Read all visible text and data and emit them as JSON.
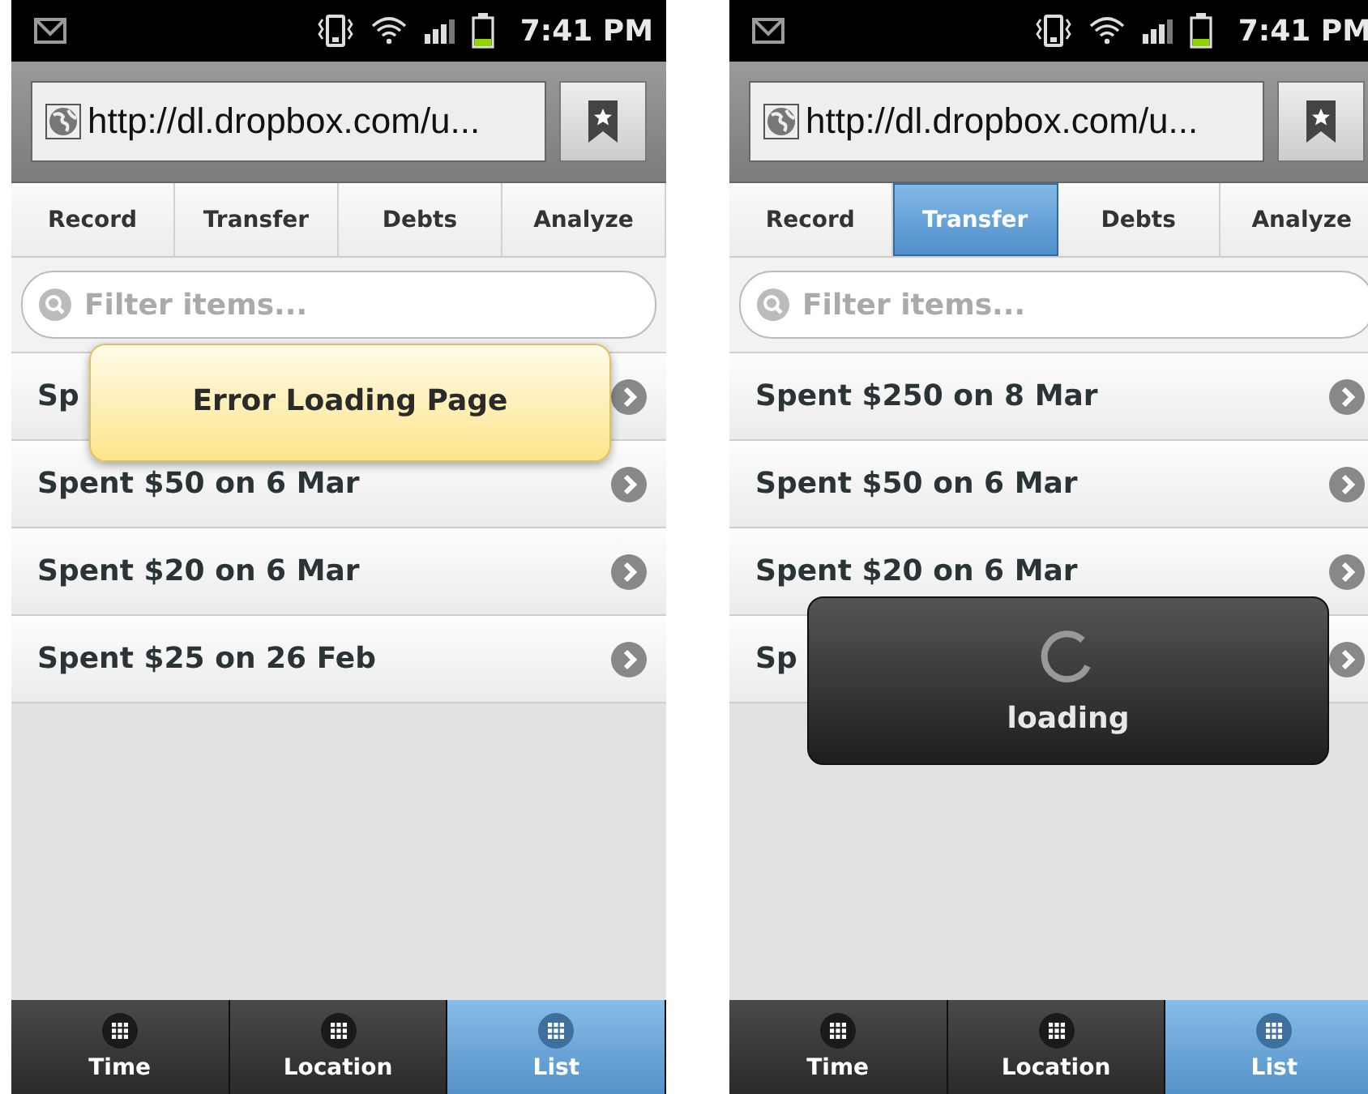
{
  "screens": [
    {
      "status_bar": {
        "time": "7:41 PM"
      },
      "url": "http://dl.dropbox.com/u...",
      "tabs": [
        {
          "label": "Record",
          "selected": false
        },
        {
          "label": "Transfer",
          "selected": false
        },
        {
          "label": "Debts",
          "selected": false
        },
        {
          "label": "Analyze",
          "selected": false
        }
      ],
      "filter": {
        "placeholder": "Filter items..."
      },
      "items": [
        {
          "text": "Sp"
        },
        {
          "text": "Spent $50 on 6 Mar"
        },
        {
          "text": "Spent $20 on 6 Mar"
        },
        {
          "text": "Spent $25 on 26 Feb"
        }
      ],
      "nav": [
        {
          "label": "Time",
          "selected": false
        },
        {
          "label": "Location",
          "selected": false
        },
        {
          "label": "List",
          "selected": true
        }
      ],
      "overlay": {
        "kind": "error",
        "text": "Error Loading Page"
      }
    },
    {
      "status_bar": {
        "time": "7:41 PM"
      },
      "url": "http://dl.dropbox.com/u...",
      "tabs": [
        {
          "label": "Record",
          "selected": false
        },
        {
          "label": "Transfer",
          "selected": true
        },
        {
          "label": "Debts",
          "selected": false
        },
        {
          "label": "Analyze",
          "selected": false
        }
      ],
      "filter": {
        "placeholder": "Filter items..."
      },
      "items": [
        {
          "text": "Spent $250 on 8 Mar"
        },
        {
          "text": "Spent $50 on 6 Mar"
        },
        {
          "text": "Spent $20 on 6 Mar"
        },
        {
          "text": "Sp"
        }
      ],
      "nav": [
        {
          "label": "Time",
          "selected": false
        },
        {
          "label": "Location",
          "selected": false
        },
        {
          "label": "List",
          "selected": true
        }
      ],
      "overlay": {
        "kind": "loading",
        "text": "loading"
      }
    }
  ]
}
